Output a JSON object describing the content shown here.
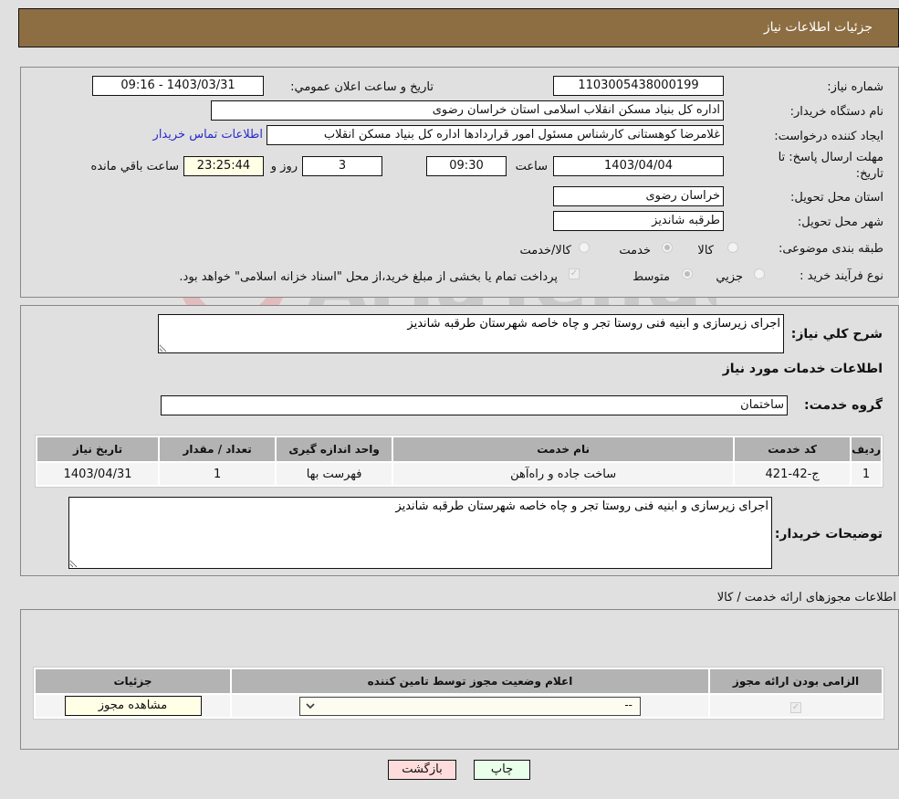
{
  "header": {
    "title": "جزئیات اطلاعات نیاز"
  },
  "details": {
    "need_number_label": "شماره نیاز:",
    "need_number": "1103005438000199",
    "announce_label": "تاریخ و ساعت اعلان عمومي:",
    "announce_value": "1403/03/31 - 09:16",
    "buyer_org_label": "نام دستگاه خریدار:",
    "buyer_org": "اداره کل بنیاد مسکن انقلاب اسلامی استان خراسان رضوی",
    "creator_label": "ایجاد کننده درخواست:",
    "creator": "غلامرضا کوهستانی کارشناس مسئول امور قراردادها اداره کل بنیاد مسکن انقلاب",
    "contact_link": "اطلاعات تماس خریدار",
    "deadline_label_1": "مهلت ارسال پاسخ: تا",
    "deadline_label_2": "تاریخ:",
    "deadline_date": "1403/04/04",
    "time_label": "ساعت",
    "deadline_time": "09:30",
    "days_value": "3",
    "days_label": "روز و",
    "remaining_time": "23:25:44",
    "remaining_label": "ساعت باقي مانده",
    "province_label": "استان محل تحویل:",
    "province": "خراسان رضوی",
    "city_label": "شهر محل تحویل:",
    "city": "طرقبه شاندیز",
    "category_label": "طبقه بندی موضوعی:",
    "category_options": [
      {
        "label": "کالا",
        "checked": false
      },
      {
        "label": "خدمت",
        "checked": true
      },
      {
        "label": "کالا/خدمت",
        "checked": false
      }
    ],
    "process_label": "نوع فرآیند خرید :",
    "process_options": [
      {
        "label": "جزيي",
        "checked": false
      },
      {
        "label": "متوسط",
        "checked": true
      }
    ],
    "payment_note": "پرداخت تمام یا بخشی از مبلغ خرید،از محل \"اسناد خزانه اسلامی\" خواهد بود."
  },
  "summary": {
    "description_label": "شرح کلي نياز:",
    "description": "اجرای زیرسازی و ابنیه فنی روستا تجر و چاه خاصه شهرستان طرقبه شاندیز",
    "services_title": "اطلاعات خدمات مورد نیاز",
    "service_group_label": "گروه خدمت:",
    "service_group": "ساختمان",
    "table": {
      "headers": [
        "ردیف",
        "کد خدمت",
        "نام خدمت",
        "واحد اندازه گیری",
        "تعداد / مقدار",
        "تاریخ نیاز"
      ],
      "rows": [
        [
          "1",
          "ج-42-421",
          "ساخت جاده و راه‌آهن",
          "فهرست بها",
          "1",
          "1403/04/31"
        ]
      ]
    },
    "buyer_notes_label": "توضیحات خریدار:",
    "buyer_notes": "اجرای زیرسازی و ابنیه فنی روستا تجر و چاه خاصه شهرستان طرقبه شاندیز"
  },
  "permits": {
    "title": "اطلاعات مجوزهای ارائه خدمت / کالا",
    "headers": [
      "الزامی بودن ارائه مجوز",
      "اعلام وضعیت مجوز توسط تامین کننده",
      "جزئیات"
    ],
    "row": {
      "required": true,
      "status_selected": "--",
      "view_button": "مشاهده مجوز"
    }
  },
  "footer": {
    "print_label": "چاپ",
    "back_label": "بازگشت"
  },
  "watermark": {
    "text": "AriaTender.neT"
  },
  "colors": {
    "header_bg": "#8d6e42",
    "print_bg": "#eaffea",
    "back_bg": "#ffdcdc",
    "link": "#2a2ad0",
    "remaining_bg": "#ffffe6"
  }
}
